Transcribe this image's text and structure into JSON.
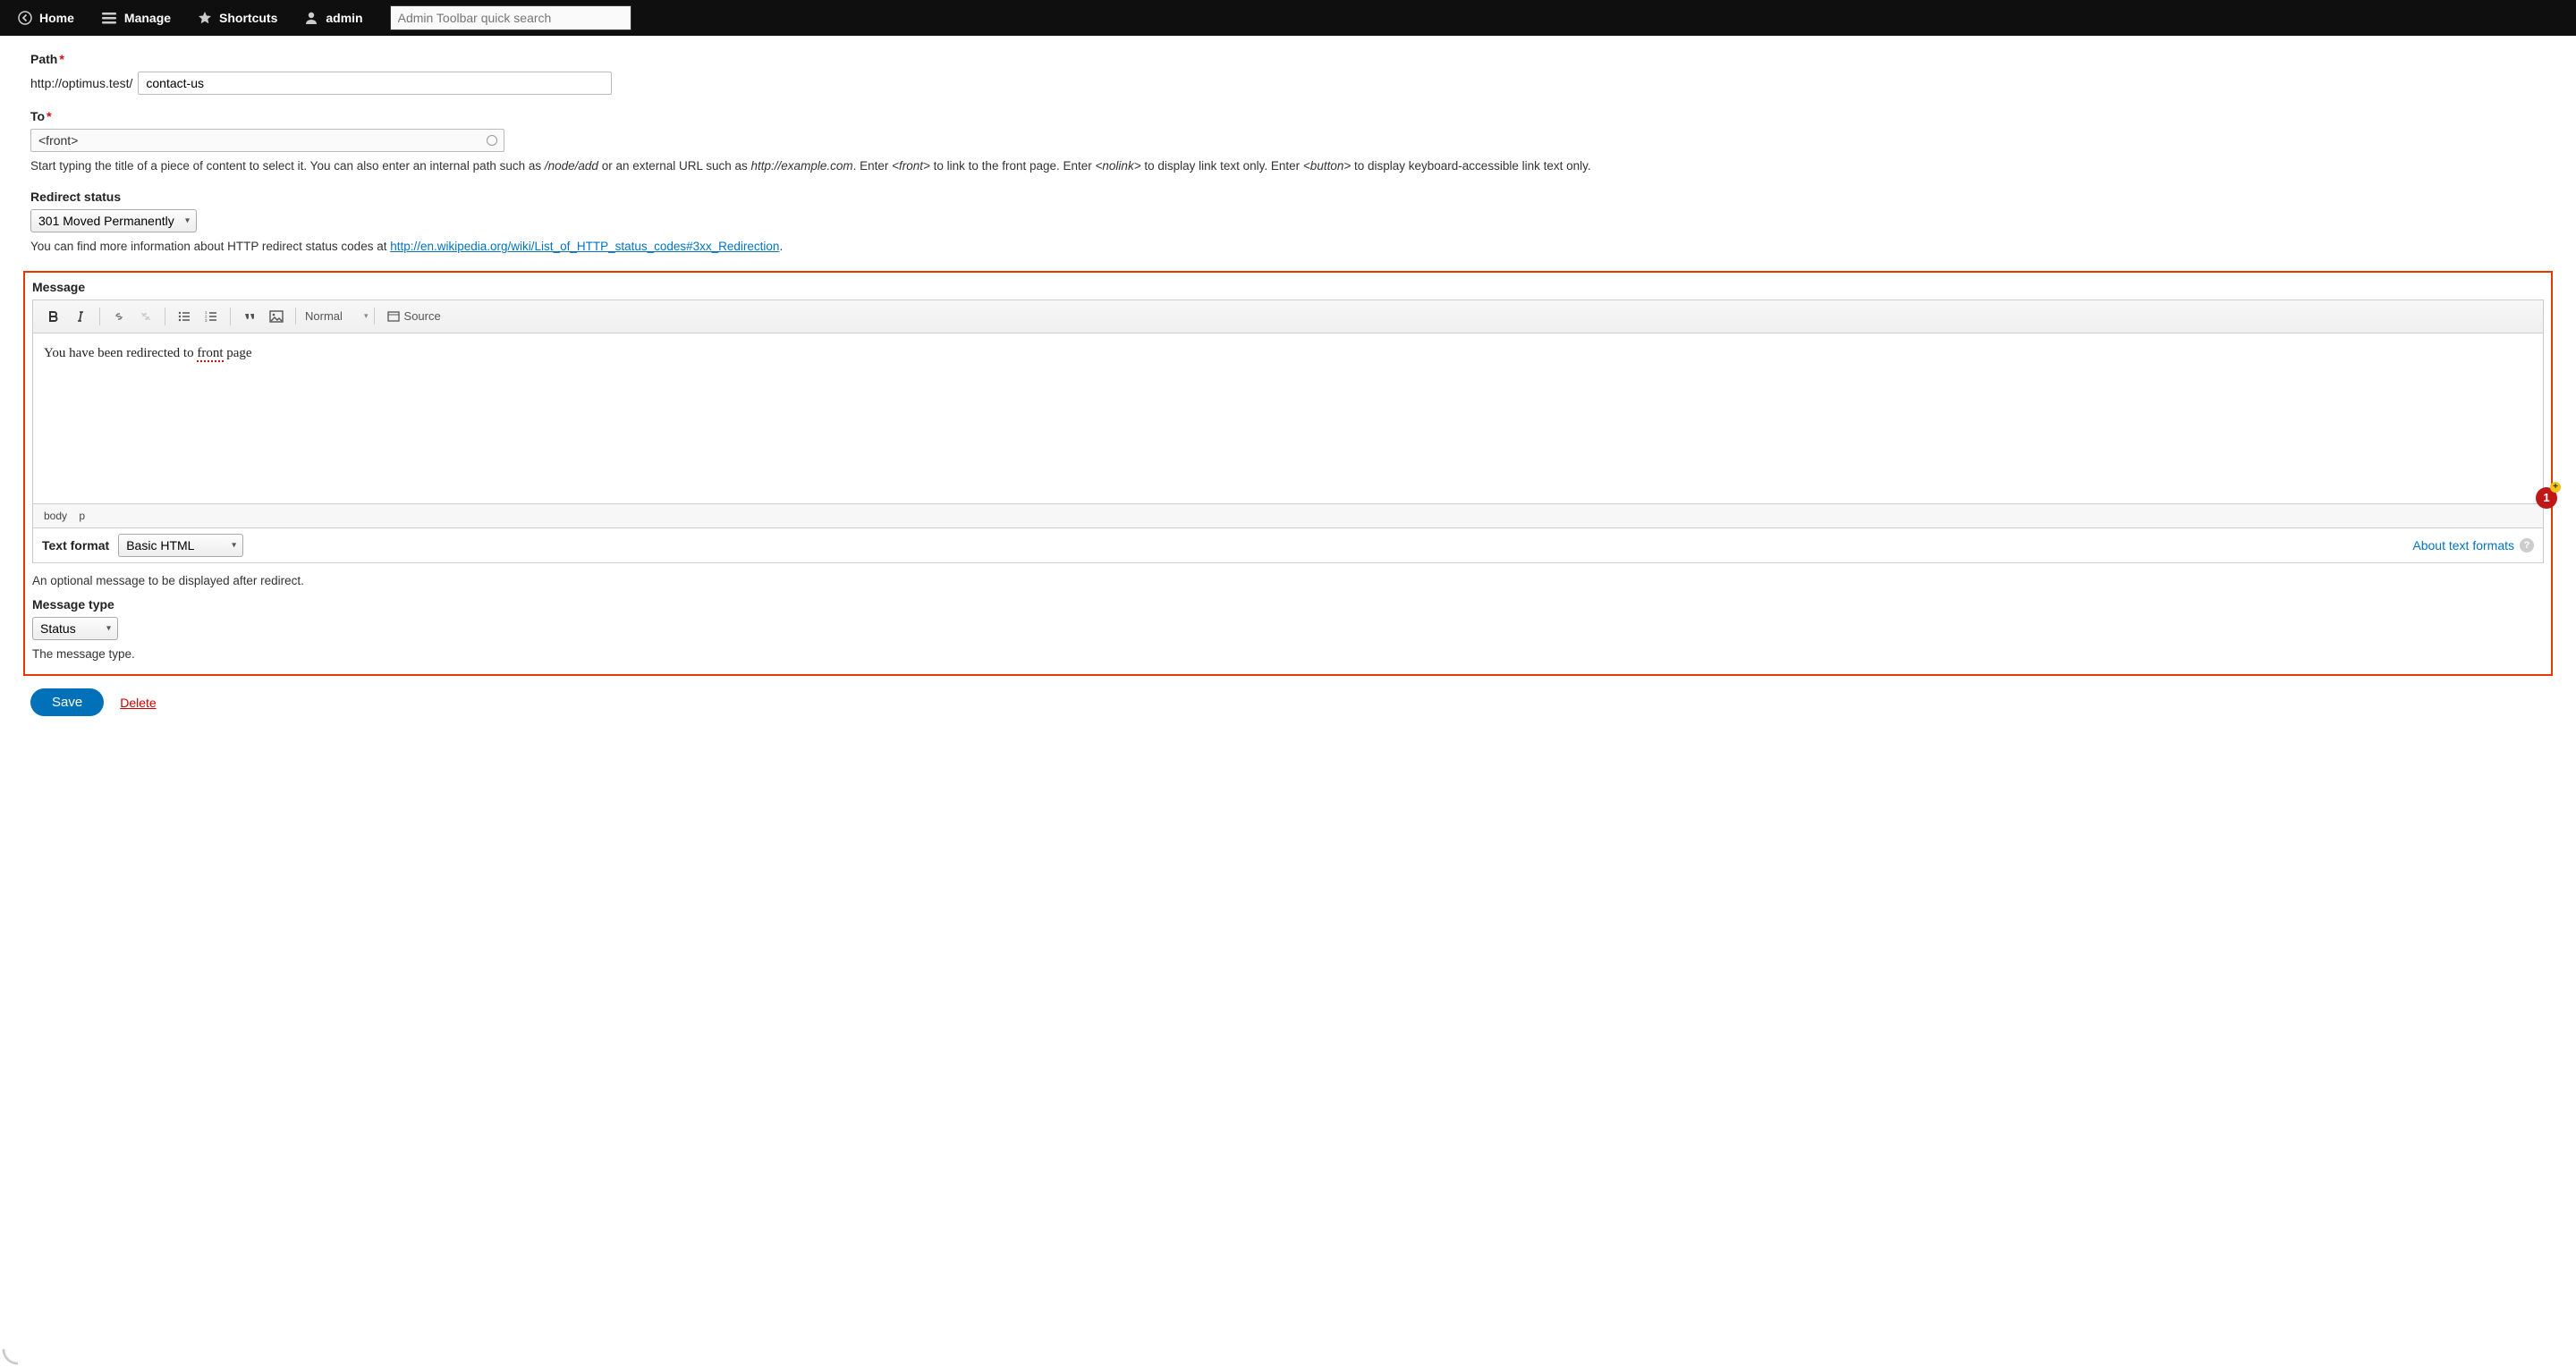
{
  "toolbar": {
    "home": "Home",
    "manage": "Manage",
    "shortcuts": "Shortcuts",
    "user": "admin",
    "search_placeholder": "Admin Toolbar quick search"
  },
  "path": {
    "label": "Path",
    "prefix": "http://optimus.test/",
    "value": "contact-us"
  },
  "to": {
    "label": "To",
    "value": "<front>",
    "desc_parts": {
      "p1": "Start typing the title of a piece of content to select it. You can also enter an internal path such as ",
      "em1": "/node/add",
      "p2": " or an external URL such as ",
      "em2": "http://example.com",
      "p3": ". Enter ",
      "em3": "<front>",
      "p4": " to link to the front page. Enter ",
      "em4": "<nolink>",
      "p5": " to display link text only. Enter ",
      "em5": "<button>",
      "p6": " to display keyboard-accessible link text only."
    }
  },
  "redirect_status": {
    "label": "Redirect status",
    "value": "301 Moved Permanently",
    "desc_prefix": "You can find more information about HTTP redirect status codes at ",
    "link_text": "http://en.wikipedia.org/wiki/List_of_HTTP_status_codes#3xx_Redirection",
    "desc_suffix": "."
  },
  "message": {
    "label": "Message",
    "editor": {
      "format_dropdown": "Normal",
      "source_label": "Source",
      "content_before": "You have been redirected to ",
      "content_err": "front",
      "content_after": " page",
      "path_body": "body",
      "path_p": "p"
    },
    "text_format_label": "Text format",
    "text_format_value": "Basic HTML",
    "about_link": "About text formats",
    "desc": "An optional message to be displayed after redirect.",
    "notif_count": "1"
  },
  "message_type": {
    "label": "Message type",
    "value": "Status",
    "desc": "The message type."
  },
  "actions": {
    "save": "Save",
    "delete": "Delete"
  }
}
